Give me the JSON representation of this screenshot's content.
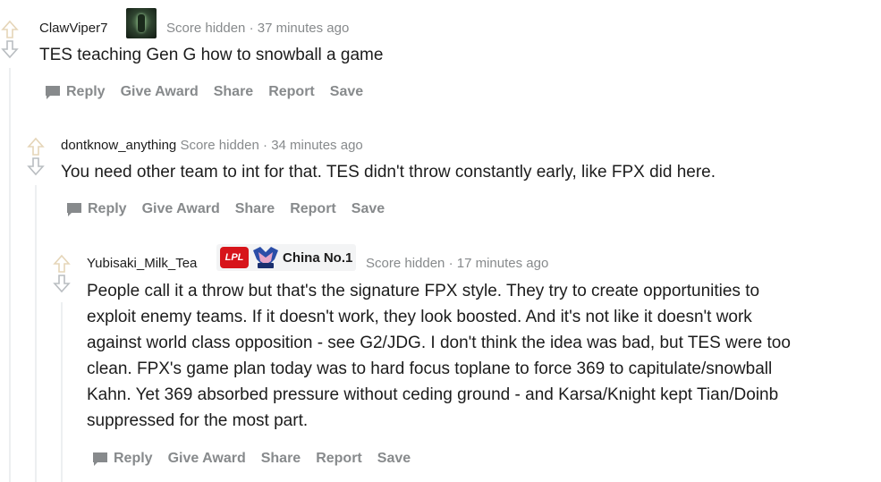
{
  "actions": {
    "reply": "Reply",
    "give_award": "Give Award",
    "share": "Share",
    "report": "Report",
    "save": "Save"
  },
  "comments": [
    {
      "author": "ClawViper7",
      "score": "Score hidden",
      "separator": "·",
      "time": "37 minutes ago",
      "body": "TES teaching Gen G how to snowball a game"
    },
    {
      "author": "dontknow_anything",
      "score": "Score hidden",
      "separator": "·",
      "time": "34 minutes ago",
      "body": "You need other team to int for that. TES didn't throw constantly early, like FPX did here."
    },
    {
      "author": "Yubisaki_Milk_Tea",
      "flair_badge": "LPL",
      "flair_text": "China No.1",
      "score": "Score hidden",
      "separator": "·",
      "time": "17 minutes ago",
      "body_lines": [
        "People call it a throw but that's the signature FPX style. They try to create opportunities to",
        "exploit enemy teams. If it doesn't work, they look boosted. And it's not like it doesn't work",
        "against world class opposition - see G2/JDG. I don't think the idea was bad, but TES were too",
        "clean. FPX's game plan today was to hard focus toplane to force 369 to capitulate/snowball",
        "Kahn. Yet 369 absorbed pressure without ceding ground - and Karsa/Knight kept Tian/Doinb",
        "suppressed for the most part."
      ]
    }
  ],
  "colors": {
    "upvote_arrow": "#e5d5b8",
    "downvote_arrow": "#b9bdc1",
    "meta_gray": "#878a8c",
    "thread_line": "#edeff1"
  }
}
